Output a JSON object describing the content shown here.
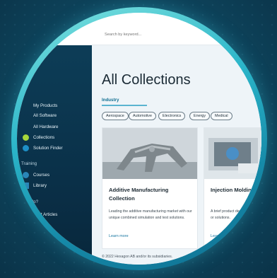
{
  "search": {
    "placeholder": "Search by keyword..."
  },
  "sidebar": {
    "items": [
      {
        "label": "My Products",
        "icon": "box-icon"
      },
      {
        "label": "All Software",
        "icon": "software-icon"
      },
      {
        "label": "All Hardware",
        "icon": "hardware-icon"
      },
      {
        "label": "Collections",
        "icon": "collections-icon"
      },
      {
        "label": "Solution Finder",
        "icon": "solution-finder-icon"
      }
    ],
    "training_label": "Training",
    "training_items": [
      {
        "label": "Courses",
        "icon": "courses-icon"
      },
      {
        "label": "Library",
        "icon": "library-icon"
      }
    ],
    "help_label": "Help?",
    "support_label": "Support Articles"
  },
  "main": {
    "title": "All Collections",
    "tab": "Industry",
    "chips": [
      "Aerospace",
      "Automotive",
      "Electronics",
      "Energy",
      "Medical"
    ],
    "cards": [
      {
        "title": "Additive Manufacturing Collection",
        "description": "Leading the additive manufacturing market with our unique combined simulation and test solutions.",
        "link": "Learn more"
      },
      {
        "title": "Injection Molding Collection",
        "description": "A brief product description of the collection features or solutions.",
        "link": "Learn more"
      }
    ],
    "footer": "© 2022 Hexagon AB and/or its subsidiaries."
  },
  "colors": {
    "accent": "#0f6e91",
    "sidebar_bg": "#0d3d57",
    "ring": "#2bb5c9",
    "collections_icon": "#a7d63b"
  }
}
